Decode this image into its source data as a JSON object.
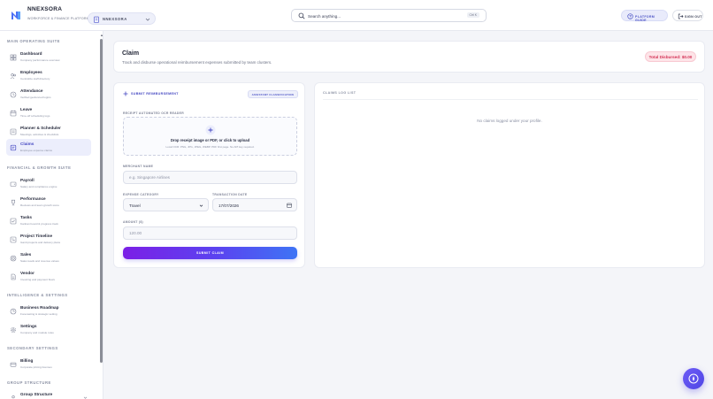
{
  "brand": {
    "name": "NNEXSORA",
    "subtitle": "WORKFORCE & FINANCE PLATFORM"
  },
  "org_selector": {
    "label": "NNEXSORA"
  },
  "search": {
    "placeholder": "Search anything...",
    "shortcut": "Ctrl K"
  },
  "header_actions": {
    "guide_label": "PLATFORM GUIDE",
    "signout_label": "SIGN OUT"
  },
  "sidebar": {
    "sections": [
      {
        "title": "MAIN OPERATING SUITE",
        "items": [
          {
            "label": "Dashboard",
            "sub": "Company performance overview",
            "icon": "grid-icon"
          },
          {
            "label": "Employees",
            "sub": "Centralize staff directory",
            "icon": "users-icon"
          },
          {
            "label": "Attendance",
            "sub": "Verified geofenced logins",
            "icon": "clock-icon"
          },
          {
            "label": "Leave",
            "sub": "Time-off scheduling logs",
            "icon": "calendar-icon"
          },
          {
            "label": "Planner & Scheduler",
            "sub": "Meetings, activities & checklists",
            "icon": "planner-icon"
          },
          {
            "label": "Claims",
            "sub": "Employee expense claims",
            "icon": "receipt-icon",
            "active": true
          }
        ]
      },
      {
        "title": "FINANCIAL & GROWTH SUITE",
        "items": [
          {
            "label": "Payroll",
            "sub": "Salary and compliance engine",
            "icon": "wallet-icon"
          },
          {
            "label": "Performance",
            "sub": "Reviews and team growth score",
            "icon": "trophy-icon"
          },
          {
            "label": "Tasks",
            "sub": "Kanban board & progress track",
            "icon": "tasks-icon"
          },
          {
            "label": "Project Timeline",
            "sub": "Gantt projects and delivery plans",
            "icon": "timeline-icon"
          },
          {
            "label": "Sales",
            "sub": "Sales leads and revenue values",
            "icon": "sales-icon"
          },
          {
            "label": "Vendor",
            "sub": "Invoicing and payment flows",
            "icon": "vendor-icon"
          }
        ]
      },
      {
        "title": "INTELLIGENCE & SETTINGS",
        "items": [
          {
            "label": "Business Roadmap",
            "sub": "Forecasting & strategic setting",
            "icon": "roadmap-icon"
          },
          {
            "label": "Settings",
            "sub": "Company and module rules",
            "icon": "gear-icon"
          }
        ]
      },
      {
        "title": "SECONDARY SETTINGS",
        "items": [
          {
            "label": "Billing",
            "sub": "Corporate pricing licenses",
            "icon": "card-icon"
          }
        ]
      },
      {
        "title": "GROUP STRUCTURE",
        "items": [
          {
            "label": "Group Structure",
            "sub": "",
            "icon": "group-icon",
            "expandable": true
          }
        ]
      }
    ]
  },
  "page": {
    "title": "Claim",
    "subtitle": "Track and disburse operational reimbursement expenses submitted by team clusters.",
    "total_badge": "Total Disbursed: $0.00"
  },
  "form": {
    "title": "SUBMIT REIMBURSEMENT",
    "tag": "ASSISTANT CLASSIFICATION",
    "receipt_label": "RECEIPT AUTOMATED OCR READER",
    "drop_title": "Drop receipt image or PDF, or click to upload",
    "drop_sub": "Local OCR: PNG, JPG, JPEG, WEBP. PDF first page. No API key required.",
    "merchant_label": "MERCHANT NAME",
    "merchant_placeholder": "e.g. Singapore Airlines",
    "category_label": "EXPENSE CATEGORY",
    "category_value": "Travel",
    "date_label": "TRANSACTION DATE",
    "date_value": "17/07/2026",
    "amount_label": "AMOUNT ($)",
    "amount_placeholder": "120.00",
    "submit_label": "SUBMIT CLAIM"
  },
  "log": {
    "title": "CLAIMS LOG LIST",
    "empty": "No claims logged under your profile."
  },
  "colors": {
    "accent": "#4548c2",
    "badge_text": "#d43155",
    "gradient_start": "#7b1fe6",
    "gradient_end": "#3e74f5"
  }
}
